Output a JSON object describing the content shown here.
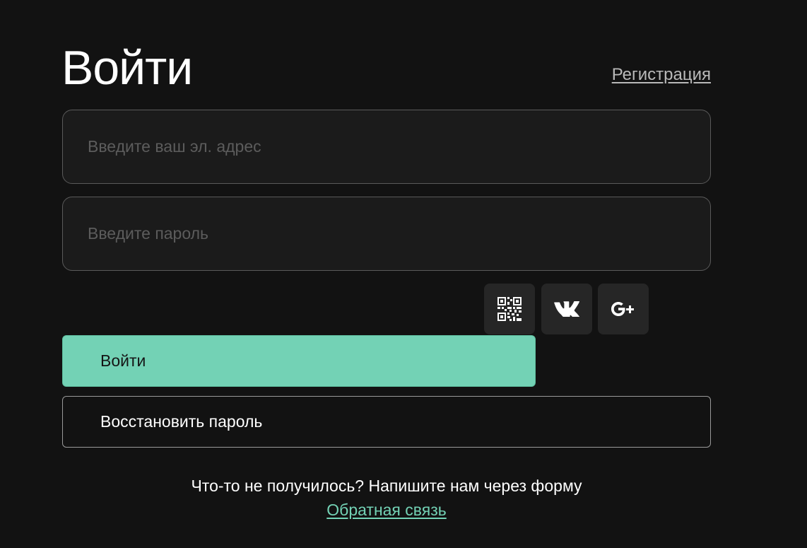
{
  "header": {
    "title": "Войти",
    "register_link": "Регистрация"
  },
  "form": {
    "email_placeholder": "Введите ваш эл. адрес",
    "email_value": "",
    "password_placeholder": "Введите пароль",
    "password_value": ""
  },
  "social": [
    {
      "icon": "qr-code-icon"
    },
    {
      "icon": "vk-icon"
    },
    {
      "icon": "google-plus-icon"
    }
  ],
  "actions": {
    "login_label": "Войти",
    "restore_label": "Восстановить пароль"
  },
  "footer": {
    "help_text": "Что-то не получилось? Напишите нам через форму",
    "feedback_link": "Обратная связь"
  },
  "colors": {
    "background": "#121212",
    "accent": "#73d2b5",
    "field_bg": "#1b1b1b",
    "social_bg": "#262626"
  }
}
